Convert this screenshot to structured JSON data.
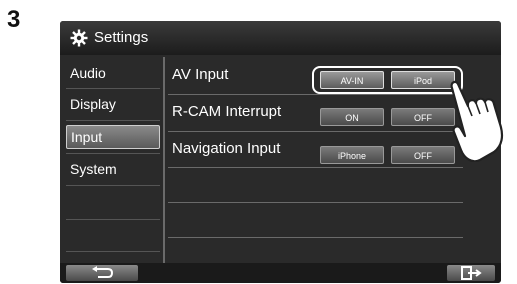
{
  "step_number": "3",
  "window": {
    "title": "Settings"
  },
  "sidebar": {
    "items": [
      {
        "label": "Audio",
        "selected": false
      },
      {
        "label": "Display",
        "selected": false
      },
      {
        "label": "Input",
        "selected": true
      },
      {
        "label": "System",
        "selected": false
      }
    ]
  },
  "settings": {
    "rows": [
      {
        "label": "AV Input",
        "options": [
          "AV-IN",
          "iPod"
        ]
      },
      {
        "label": "R-CAM Interrupt",
        "options": [
          "ON",
          "OFF"
        ]
      },
      {
        "label": "Navigation Input",
        "options": [
          "iPhone",
          "OFF"
        ]
      }
    ]
  },
  "icons": {
    "title": "gear-icon",
    "back": "back-arrow-icon",
    "exit": "exit-icon",
    "pointer": "hand-pointer-icon"
  }
}
